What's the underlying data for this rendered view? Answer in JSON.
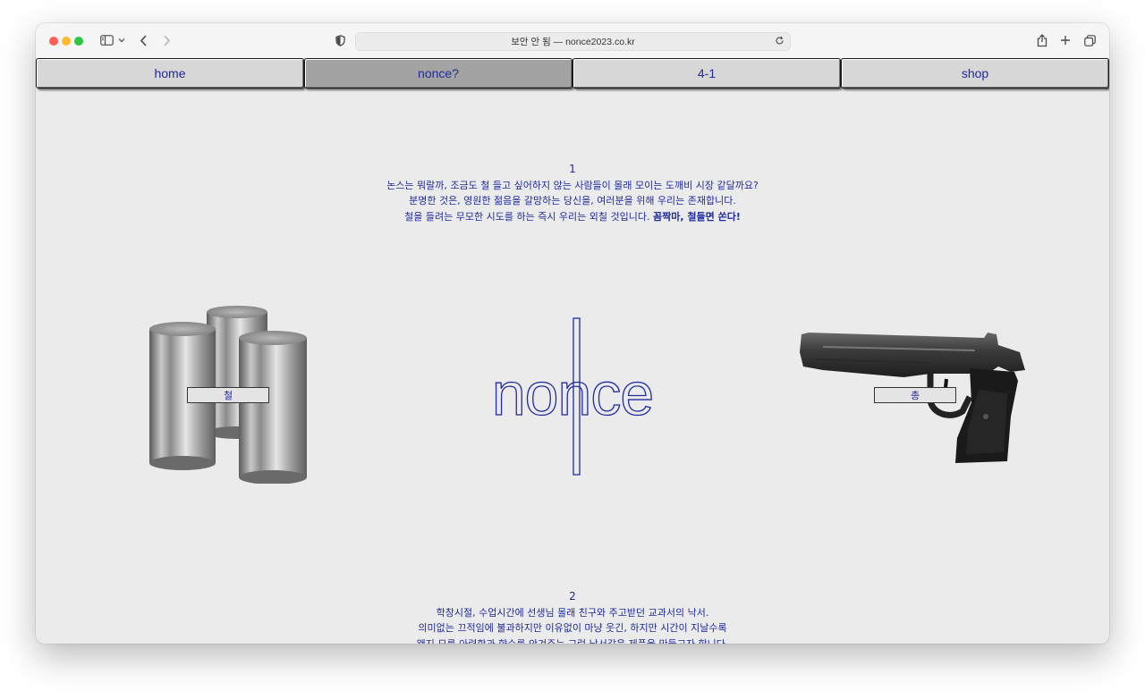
{
  "browser": {
    "address": "보안 안 됨 — nonce2023.co.kr"
  },
  "nav": {
    "items": [
      {
        "label": "home"
      },
      {
        "label": "nonce?"
      },
      {
        "label": "4-1"
      },
      {
        "label": "shop"
      }
    ],
    "active_index": 1
  },
  "section1": {
    "number": "1",
    "line1": "논스는 뭐랄까, 조금도 철 들고 싶어하지 않는 사람들이 몰래 모이는 도깨비 시장 같달까요?",
    "line2": "분명한 것은, 영원한 젊음을 갈망하는 당신을, 여러분을 위해 우리는 존재합니다.",
    "line3_a": "철을 들려는 무모한 시도를 하는 즉시 우리는 외칠 것입니다. ",
    "line3_b": "꼼짝마, 철들면 쏜다!"
  },
  "products": {
    "left_label": "철",
    "right_label": "총"
  },
  "logo": {
    "text": "nonce"
  },
  "section2": {
    "number": "2",
    "line1": "학창시절, 수업시간에 선생님 몰래 친구와 주고받던 교과서의 낙서.",
    "line2": "의미없는 끄적임에 불과하지만 이유없이 마냥 웃긴, 하지만 시간이 지날수록",
    "line3": "왠지 모를 아련함과 향수를 안겨주는 그런 낙서같은 제품을 만들고자 합니다."
  },
  "colors": {
    "accent": "#1f2b9e",
    "page_bg": "#ebebeb",
    "nav_bg": "#d7d7d7",
    "nav_active_bg": "#a3a3a3"
  },
  "icons": [
    "sidebar-toggle-icon",
    "chevron-down-icon",
    "back-arrow-icon",
    "forward-arrow-icon",
    "privacy-shield-icon",
    "reload-icon",
    "share-icon",
    "new-tab-icon",
    "tab-overview-icon"
  ]
}
